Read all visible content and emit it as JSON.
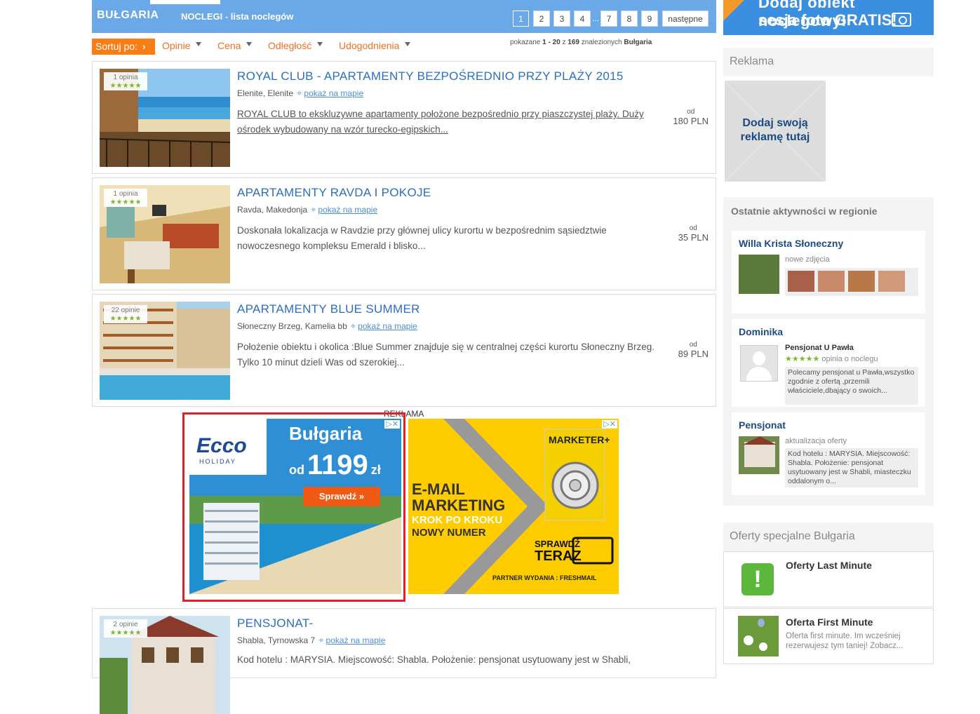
{
  "header": {
    "country": "BUŁGARIA",
    "subtitle": "NOCLEGI - lista noclegów",
    "pages": [
      "1",
      "2",
      "3",
      "4",
      "...",
      "7",
      "8",
      "9"
    ],
    "next_label": "następne",
    "active_page": "1"
  },
  "sort": {
    "label": "Sortuj po:",
    "options": [
      "Opinie",
      "Cena",
      "Odległość",
      "Udogodnienia"
    ]
  },
  "results": {
    "prefix": "pokazane",
    "range": "1 - 20",
    "of": "z",
    "total": "169",
    "found": "znalezionych",
    "region": "Bułgaria"
  },
  "listings": [
    {
      "reviews": "1 opinia",
      "stars": "★★★★★",
      "title": "ROYAL CLUB - APARTAMENTY BEZPOŚREDNIO PRZY PLAŻY 2015",
      "location": "Elenite, Elenite",
      "map_link": "pokaż na mapie",
      "description": "ROYAL CLUB to ekskluzywne apartamenty położone bezpośrednio przy piaszczystej plaży. Duży ośrodek wybudowany na wzór turecko-egipskich...",
      "price_from": "od",
      "price": "180 PLN"
    },
    {
      "reviews": "1 opinia",
      "stars": "★★★★★",
      "title": "APARTAMENTY RAVDA I POKOJE",
      "location": "Ravda, Makedonja",
      "map_link": "pokaż na mapie",
      "description": " Doskonała lokalizacja w Ravdzie przy głównej ulicy kurortu w bezpośrednim sąsiedztwie nowoczesnego kompleksu Emerald i blisko...",
      "price_from": "od",
      "price": "35 PLN"
    },
    {
      "reviews": "22 opinie",
      "stars": "★★★★★",
      "title": "APARTAMENTY BLUE SUMMER",
      "location": "Słoneczny Brzeg, Kamelia bb",
      "map_link": "pokaż na mapie",
      "description": "Położenie obiektu i okolica :Blue Summer znajduje się w centralnej części kurortu Słoneczny Brzeg.  Tylko 10 minut dzieli Was od szerokiej...",
      "price_from": "od",
      "price": "89 PLN"
    },
    {
      "reviews": "2 opinie",
      "stars": "★★★★★",
      "title": "PENSJONAT-",
      "location": "Shabla, Tyrnowska 7",
      "map_link": "pokaż na mapie",
      "description": " Kod hotelu : MARYSIA. Miejscowość: Shabla. Położenie: pensjonat usytuowany jest w Shabli,",
      "price_from": "",
      "price": ""
    }
  ],
  "ads": {
    "label": "REKLAMA",
    "ad1": {
      "brand": "Ecco",
      "brand_sub": "HOLIDAY",
      "headline": "Bułgaria",
      "price_prefix": "od",
      "price": "1199",
      "currency": "zł",
      "cta": "Sprawdź »"
    },
    "ad2": {
      "line1": "E-MAIL",
      "line2": "MARKETING",
      "line3": "KROK PO KROKU",
      "line4": "NOWY NUMER",
      "magazine": "MARKETER+",
      "cta1": "SPRAWDŹ",
      "cta2": "TERAZ",
      "partner": "PARTNER WYDANIA :",
      "partner_name": "FRESHMAIL"
    }
  },
  "sidebar": {
    "banner_line1": "Dodaj obiekt noclegowy!",
    "banner_line2": "sesja foto GRATIS!",
    "ad_heading": "Reklama",
    "ad_placeholder_line1": "Dodaj swoją",
    "ad_placeholder_line2": "reklamę tutaj",
    "activity_heading": "Ostatnie aktywności w regionie",
    "activities": [
      {
        "name": "Willa Krista Słoneczny",
        "type": "nowe zdjęcia"
      },
      {
        "name": "Dominika",
        "object": "Pensjonat U Pawła",
        "stars": "★★★★★",
        "type": "opinia o noclegu",
        "text": "Polecamy pensjonat u Pawła,wszystko zgodnie z ofertą ,przemili właściciele,dbający o swoich..."
      },
      {
        "name": "Pensjonat",
        "type": "aktualizacja oferty",
        "text": "Kod hotelu : MARYSIA. Miejscowość: Shabla. Położenie: pensjonat usytuowany jest w Shabli, miasteczku oddalonym o..."
      }
    ],
    "special_heading": "Oferty specjalne Bułgaria",
    "specials": [
      {
        "title": "Oferty Last Minute",
        "desc": ""
      },
      {
        "title": "Oferta First Minute",
        "desc": "Oferta first minute. Im wcześniej rezerwujesz tym taniej! Zobacz..."
      }
    ]
  },
  "colors": {
    "header_blue": "#6aa8e8",
    "sort_orange": "#f77d14",
    "link_blue": "#2a6fc0",
    "star_green": "#7cb82f",
    "ad_frame_red": "#e0202a"
  }
}
